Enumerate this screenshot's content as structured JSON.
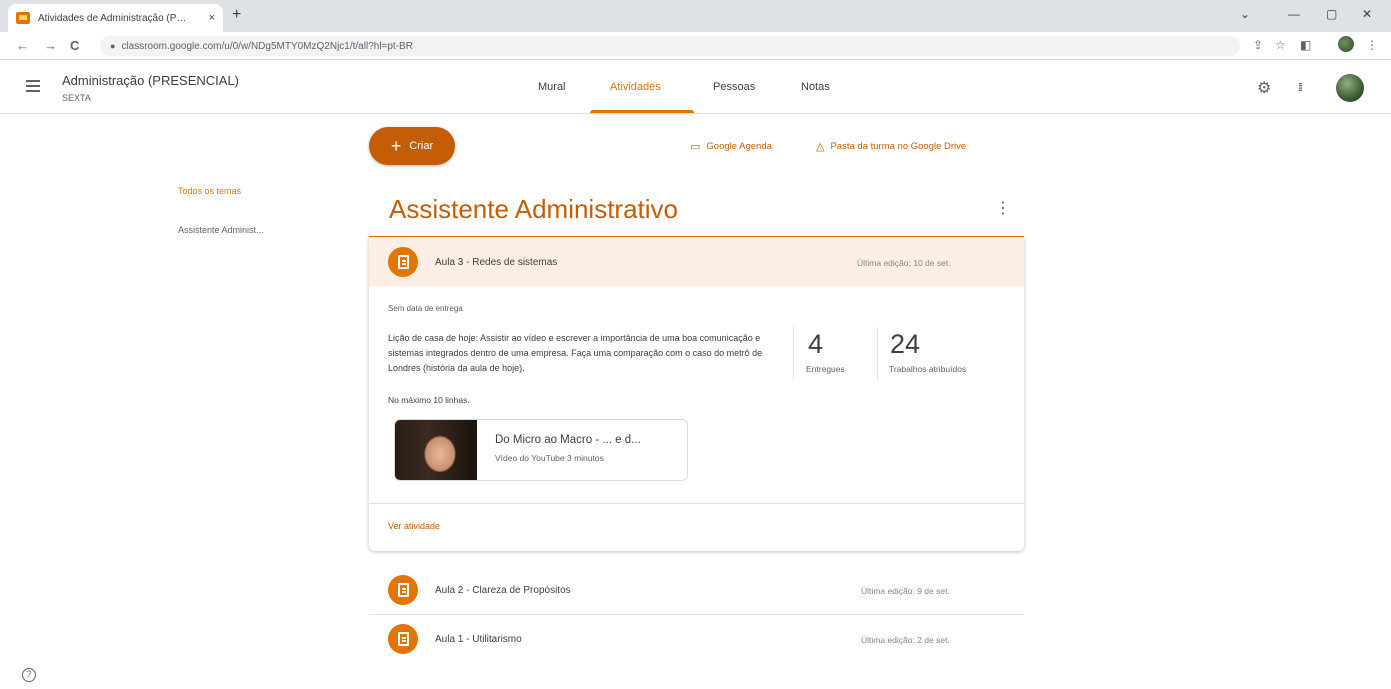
{
  "browser": {
    "tab_title": "Atividades de Administração (P…",
    "tab_close": "×",
    "new_tab": "+",
    "url": "classroom.google.com/u/0/w/NDg5MTY0MzQ2Njc1/t/all?hl=pt-BR",
    "back": "←",
    "forward": "→",
    "reload": "C",
    "lock": "🔒",
    "minimize": "—",
    "maximize": "▢",
    "close": "✕",
    "dropdown": "⌄"
  },
  "header": {
    "class_name": "Administração (PRESENCIAL)",
    "section": "SEXTA",
    "tabs": [
      {
        "label": "Mural"
      },
      {
        "label": "Atividades"
      },
      {
        "label": "Pessoas"
      },
      {
        "label": "Notas"
      }
    ],
    "settings_icon": "⚙",
    "apps_icon": "⋮⋮⋮"
  },
  "topics": {
    "all": "Todos os temas",
    "items": [
      "Assistente Administ..."
    ]
  },
  "actions": {
    "create_label": "Criar",
    "create_plus": "+",
    "calendar_label": "Google Agenda",
    "calendar_icon": "calendar-icon",
    "drive_label": "Pasta da turma no Google Drive",
    "drive_icon": "drive-icon"
  },
  "topic": {
    "title": "Assistente Administrativo",
    "menu": "⋮",
    "assignments": [
      {
        "title": "Aula 3 - Redes de sistemas",
        "date": "Última edição: 10 de set.",
        "due": "Sem data de entrega",
        "description": "Lição de casa de hoje: Assistir ao vídeo e escrever a importância de uma boa comunicação e sistemas integrados dentro de uma empresa. Faça uma comparação com o caso do metrô de Londres (história da aula de hoje).",
        "limit": "No máximo 10 linhas.",
        "turned_in": "4",
        "turned_in_label": "Entregues",
        "assigned": "24",
        "assigned_label": "Trabalhos atribuídos",
        "attachment_title": "Do Micro ao Macro - ... e d...",
        "attachment_sub": "Vídeo do YouTube   3 minutos",
        "view": "Ver atividade"
      },
      {
        "title": "Aula 2 - Clareza de Propósitos",
        "date": "Última edição: 9 de set."
      },
      {
        "title": "Aula 1 - Utilitarismo",
        "date": "Última edição: 2 de set."
      }
    ]
  },
  "colors": {
    "accent": "#e37400",
    "accent_dark": "#c55d07",
    "header_tint": "#fdeee3"
  },
  "help": "?"
}
